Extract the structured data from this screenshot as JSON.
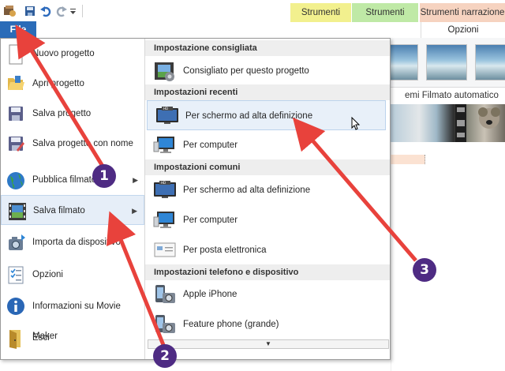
{
  "ribbon": {
    "contextual_tabs": {
      "video": "Strumenti video",
      "music": "Strumenti musica",
      "narration": "Strumenti narrazione"
    },
    "file_tab": "File",
    "options_tab": "Opzioni",
    "auto_movie_label": "emi Filmato automatico"
  },
  "file_menu": {
    "items": [
      {
        "label": "Nuovo progetto",
        "icon": "new-document-icon"
      },
      {
        "label": "Apri progetto",
        "icon": "open-folder-icon"
      },
      {
        "label": "Salva progetto",
        "icon": "save-disk-icon"
      },
      {
        "label": "Salva progetto con nome",
        "icon": "save-as-icon"
      },
      {
        "label": "Pubblica filmato",
        "icon": "globe-publish-icon",
        "submenu": true
      },
      {
        "label": "Salva filmato",
        "icon": "film-save-icon",
        "submenu": true,
        "highlighted": true
      },
      {
        "label": "Importa da dispositivo",
        "icon": "camera-import-icon"
      },
      {
        "label": "Opzioni",
        "icon": "checklist-icon"
      },
      {
        "label": "Informazioni su Movie Maker",
        "icon": "info-icon"
      },
      {
        "label": "Esci",
        "icon": "exit-icon"
      }
    ],
    "submenu_arrow": "▶"
  },
  "save_movie_submenu": {
    "sections": [
      {
        "title": "Impostazione consigliata",
        "items": [
          {
            "label": "Consigliato per questo progetto",
            "icon": "recommended-settings-icon"
          }
        ]
      },
      {
        "title": "Impostazioni recenti",
        "items": [
          {
            "label": "Per schermo ad alta definizione",
            "icon": "hd-screen-icon",
            "highlighted": true
          },
          {
            "label": "Per computer",
            "icon": "computer-monitor-icon"
          }
        ]
      },
      {
        "title": "Impostazioni comuni",
        "items": [
          {
            "label": "Per schermo ad alta definizione",
            "icon": "hd-screen-icon"
          },
          {
            "label": "Per computer",
            "icon": "computer-monitor-icon"
          },
          {
            "label": "Per posta elettronica",
            "icon": "email-icon"
          }
        ]
      },
      {
        "title": "Impostazioni telefono e dispositivo",
        "items": [
          {
            "label": "Apple iPhone",
            "icon": "phone-camera-icon"
          },
          {
            "label": "Feature phone (grande)",
            "icon": "phone-camera-icon"
          }
        ]
      }
    ],
    "scroll_more": "▼"
  },
  "annotations": {
    "badges": [
      "1",
      "2",
      "3"
    ],
    "color": "#4e2b83",
    "arrow_color": "#e8423c"
  }
}
